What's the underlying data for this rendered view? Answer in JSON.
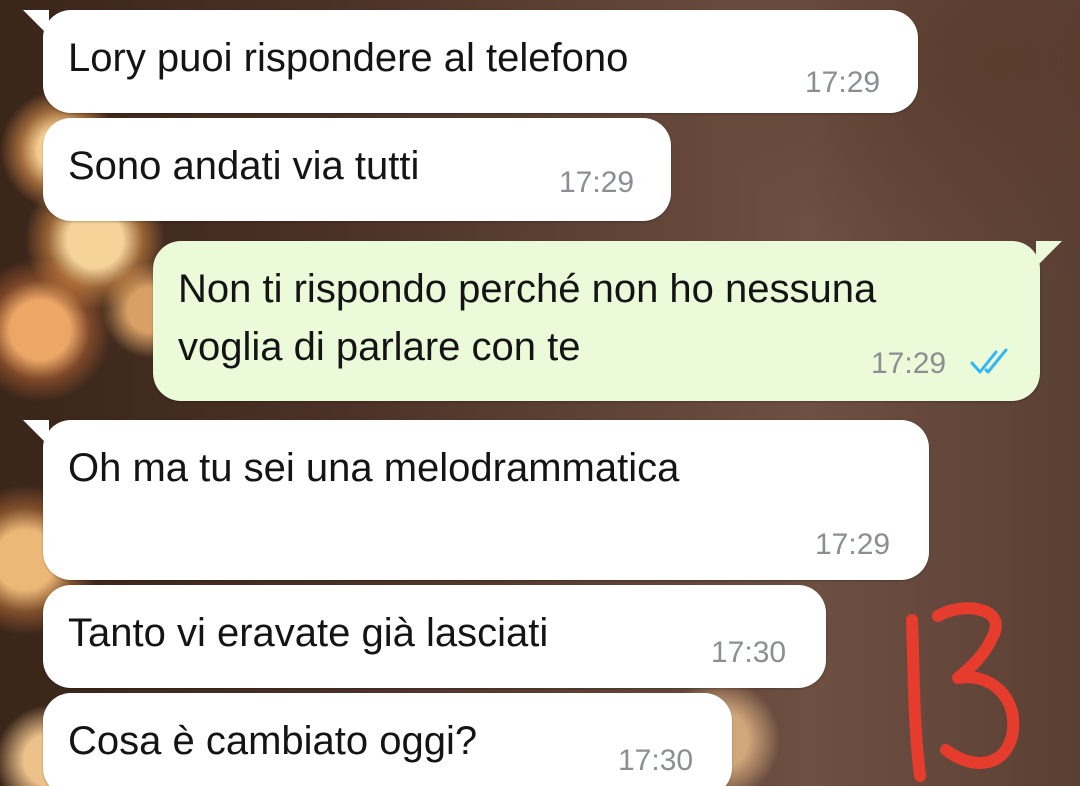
{
  "messages": [
    {
      "direction": "incoming",
      "text": "Lory puoi rispondere al telefono",
      "time": "17:29"
    },
    {
      "direction": "incoming",
      "text": "Sono andati via tutti",
      "time": "17:29"
    },
    {
      "direction": "outgoing",
      "lines": [
        "Non ti rispondo perché non ho nessuna",
        "voglia di parlare con te"
      ],
      "time": "17:29",
      "status": "read"
    },
    {
      "direction": "incoming",
      "text": "Oh ma tu sei una melodrammatica",
      "time": "17:29"
    },
    {
      "direction": "incoming",
      "text": "Tanto vi eravate già lasciati",
      "time": "17:30"
    },
    {
      "direction": "incoming",
      "text": "Cosa è cambiato oggi?",
      "time": "17:30"
    }
  ],
  "annotation": {
    "text": "13",
    "color": "#e63c2e"
  },
  "colors": {
    "incoming_bubble": "#ffffff",
    "outgoing_bubble": "#ebfad9",
    "timestamp": "#8a8f92",
    "read_ticks": "#34b7f1"
  },
  "icons": {
    "read_receipt": "double-check-icon"
  }
}
